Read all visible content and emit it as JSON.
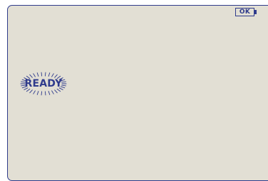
{
  "status": {
    "battery_label": "OK",
    "ready_label": "READY"
  },
  "colors": {
    "screen_background": "#e2dfd4",
    "ink": "#2f3b8c"
  },
  "icons": {
    "battery": "battery-icon",
    "ready_glow": "glow-rays-icon"
  }
}
